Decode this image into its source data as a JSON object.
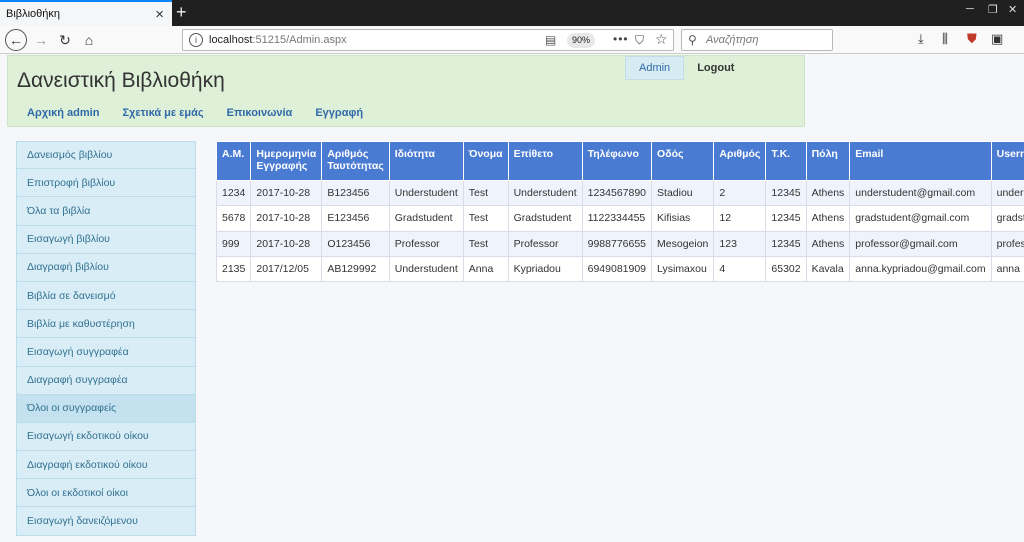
{
  "browser": {
    "tab_title": "Βιβλιοθήκη",
    "url_host": "localhost",
    "url_rest": ":51215/Admin.aspx",
    "zoom": "90%",
    "search_placeholder": "Αναζήτηση"
  },
  "header": {
    "title": "Δανειστική Βιβλιοθήκη",
    "nav": [
      "Αρχική admin",
      "Σχετικά με εμάς",
      "Επικοινωνία",
      "Εγγραφή"
    ],
    "admin_label": "Admin",
    "logout_label": "Logout"
  },
  "sidebar": {
    "items": [
      "Δανεισμός βιβλίου",
      "Επιστροφή βιβλίου",
      "Όλα τα βιβλία",
      "Εισαγωγή βιβλίου",
      "Διαγραφή βιβλίου",
      "Βιβλία σε δανεισμό",
      "Βιβλία με καθυστέρηση",
      "Εισαγωγή συγγραφέα",
      "Διαγραφή συγγραφέα",
      "Όλοι οι συγγραφείς",
      "Εισαγωγή εκδοτικού οίκου",
      "Διαγραφή εκδοτικού οίκου",
      "Όλοι οι εκδοτικοί οίκοι",
      "Εισαγωγή δανειζόμενου"
    ],
    "active": "Όλοι οι συγγραφείς"
  },
  "table": {
    "columns": [
      "Α.Μ.",
      "Ημερομηνία Εγγραφής",
      "Αριθμός Ταυτότητας",
      "Ιδιότητα",
      "Όνομα",
      "Επίθετο",
      "Τηλέφωνο",
      "Οδός",
      "Αριθμός",
      "Τ.Κ.",
      "Πόλη",
      "Email",
      "Username"
    ],
    "rows": [
      [
        "1234",
        "2017-10-28",
        "B123456",
        "Understudent",
        "Test",
        "Understudent",
        "1234567890",
        "Stadiou",
        "2",
        "12345",
        "Athens",
        "understudent@gmail.com",
        "understudent"
      ],
      [
        "5678",
        "2017-10-28",
        "E123456",
        "Gradstudent",
        "Test",
        "Gradstudent",
        "1122334455",
        "Kifisias",
        "12",
        "12345",
        "Athens",
        "gradstudent@gmail.com",
        "gradstudent"
      ],
      [
        "999",
        "2017-10-28",
        "O123456",
        "Professor",
        "Test",
        "Professor",
        "9988776655",
        "Mesogeion",
        "123",
        "12345",
        "Athens",
        "professor@gmail.com",
        "professor"
      ],
      [
        "2135",
        "2017/12/05",
        "AB129992",
        "Understudent",
        "Anna",
        "Kypriadou",
        "6949081909",
        "Lysimaxou",
        "4",
        "65302",
        "Kavala",
        "anna.kypriadou@gmail.com",
        "anna"
      ]
    ]
  }
}
